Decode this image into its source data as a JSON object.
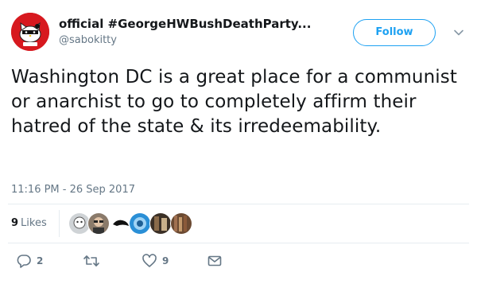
{
  "user": {
    "display_name": "official #GeorgeHWBushDeathParty...",
    "handle": "@sabokitty",
    "avatar_icon": "hello-kitty-avatar-icon"
  },
  "header": {
    "follow_label": "Follow",
    "menu_icon": "chevron-down-icon"
  },
  "tweet": {
    "text": "Washington DC is a great place for a communist or anarchist to go to completely affirm their hatred of the state & its irredeemability.",
    "timestamp": "11:16 PM - 26 Sep 2017"
  },
  "likes": {
    "count": "9",
    "label": "Likes",
    "liker_count_shown": 7
  },
  "actions": {
    "reply_count": "2",
    "retweet_count": "",
    "like_count": "9"
  },
  "colors": {
    "accent": "#1da1f2",
    "text": "#14171a",
    "muted": "#657786",
    "avatar_bg": "#d7191f"
  }
}
